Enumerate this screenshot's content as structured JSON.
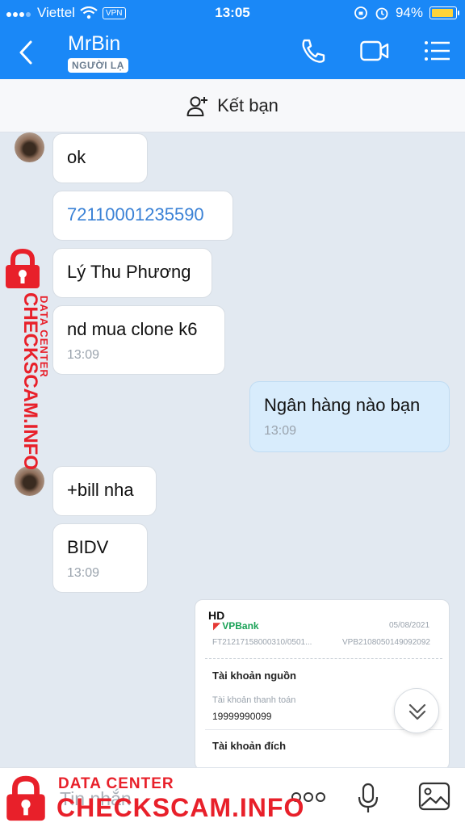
{
  "status_bar": {
    "carrier": "Viettel",
    "vpn": "VPN",
    "time": "13:05",
    "battery": "94%"
  },
  "header": {
    "name": "MrBin",
    "tag": "NGƯỜI LẠ"
  },
  "add_friend": {
    "label": "Kết bạn"
  },
  "messages": [
    {
      "text": "ok",
      "time": ""
    },
    {
      "text": "72110001235590",
      "time": ""
    },
    {
      "text": "Lý Thu Phương",
      "time": ""
    },
    {
      "text": "nd mua clone k6",
      "time": "13:09"
    },
    {
      "text": "Ngân hàng nào bạn",
      "time": "13:09"
    },
    {
      "text": "+bill nha",
      "time": ""
    },
    {
      "text": "BIDV",
      "time": "13:09"
    }
  ],
  "bill": {
    "hd": "HD",
    "bank": "VPBank",
    "date": "05/08/2021",
    "ref1": "FT21217158000310/0501...",
    "ref2": "VPB2108050149092092",
    "source_title": "Tài khoản nguồn",
    "source_type": "Tài khoản thanh toán",
    "source_number": "19999990099",
    "dest_title": "Tài khoản đích"
  },
  "input": {
    "placeholder": "Tin nhắn"
  },
  "watermark": {
    "line1": "DATA CENTER",
    "line2": "CHECKSCAM.INFO"
  },
  "icons": [
    "back-icon",
    "phone-icon",
    "video-icon",
    "menu-icon",
    "add-user-icon",
    "chevron-down-icon",
    "more-icon",
    "mic-icon",
    "image-icon"
  ],
  "colors": {
    "header": "#1a88f7",
    "background": "#e2e9f1",
    "my_bubble": "#d8ecfc",
    "link": "#3b82d6",
    "watermark": "#e8202a"
  }
}
